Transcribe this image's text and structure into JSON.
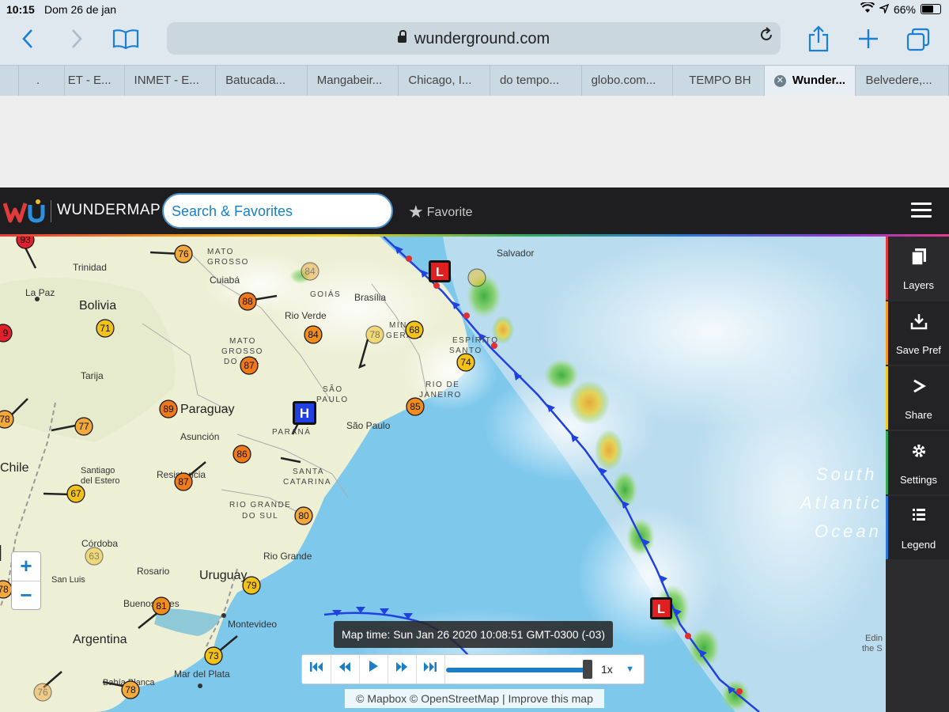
{
  "status_bar": {
    "time": "10:15",
    "date": "Dom 26 de jan",
    "battery": "66%"
  },
  "browser": {
    "url": "wunderground.com",
    "tabs": [
      {
        "label": "."
      },
      {
        "label": "ET - E..."
      },
      {
        "label": "INMET - E..."
      },
      {
        "label": "Batucada..."
      },
      {
        "label": "Mangabeir..."
      },
      {
        "label": "Chicago, I..."
      },
      {
        "label": "do tempo..."
      },
      {
        "label": "globo.com..."
      },
      {
        "label": "TEMPO BH"
      },
      {
        "label": "Wunder...",
        "active": true
      },
      {
        "label": "Belvedere,..."
      }
    ]
  },
  "wundermap": {
    "brand": "WUNDERMAP",
    "search_placeholder": "Search & Favorites",
    "favorite_label": "Favorite"
  },
  "side_panel": [
    {
      "label": "Layers",
      "icon": "layers-icon",
      "accent": "#e03a3a"
    },
    {
      "label": "Save Pref",
      "icon": "download-icon",
      "accent": "#f39a1b"
    },
    {
      "label": "Share",
      "icon": "share-icon",
      "accent": "#f2cc1b"
    },
    {
      "label": "Settings",
      "icon": "gear-icon",
      "accent": "#36a85a"
    },
    {
      "label": "Legend",
      "icon": "list-icon",
      "accent": "#2d77d4"
    }
  ],
  "map": {
    "zoom_in": "+",
    "zoom_out": "−",
    "map_time": "Map time: Sun Jan 26 2020 10:08:51 GMT-0300 (-03)",
    "speed": "1x",
    "attribution": "© Mapbox © OpenStreetMap | Improve this map",
    "labels": {
      "bolivia": "Bolivia",
      "paraguay": "Paraguay",
      "chile": "Chile",
      "argentina": "Argentina",
      "uruguay": "Uruguay",
      "mato_grosso": [
        "MATO",
        "GROSSO"
      ],
      "mato_grosso_do_sul": [
        "MATO",
        "GROSSO",
        "DO SUL"
      ],
      "goias": "GOIÁS",
      "minas_gerais": [
        "MINAS",
        "GERAIS"
      ],
      "espirito_santo": [
        "ESPÍRITO",
        "SANTO"
      ],
      "sao_paulo_state": [
        "SÃO",
        "PAULO"
      ],
      "rio_de_janeiro_state": [
        "RIO DE",
        "JANEIRO"
      ],
      "parana": "PARANÁ",
      "santa_catarina": [
        "SANTA",
        "CATARINA"
      ],
      "rio_grande_do_sul": [
        "RIO GRANDE",
        "DO SUL"
      ],
      "trinidad": "Trinidad",
      "la_paz": "La Paz",
      "cuiaba": "Cuiabá",
      "rio_verde": "Rio Verde",
      "brasilia": "Brasília",
      "salvador": "Salvador",
      "tarija": "Tarija",
      "asuncion": "Asunción",
      "santiago_del_estero": [
        "Santiago",
        "del Estero"
      ],
      "resistencia": "Resistencia",
      "sao_paulo": "São Paulo",
      "cordoba": "Córdoba",
      "rosario": "Rosario",
      "san_luis": "San Luis",
      "buenos_aires": "Buenos Aires",
      "montevideo": "Montevideo",
      "rio_grande": "Rio Grande",
      "mar_del_plata": "Mar del Plata",
      "bahia_blanca": "Bahía Blanca",
      "south_atlantic_ocean": [
        "South",
        "Atlantic",
        "Ocean"
      ],
      "edinburgh": [
        "Edin",
        "the S"
      ]
    },
    "station_temps": {
      "t93": "93",
      "t76a": "76",
      "t84a": "84",
      "t88": "88",
      "t71": "71",
      "t84b": "84",
      "t87a": "87",
      "t78a": "78",
      "t68": "68",
      "t74": "74",
      "t89": "89",
      "t77": "77",
      "t78b": "78",
      "t85": "85",
      "t86": "86",
      "t87b": "87",
      "t67": "67",
      "t80": "80",
      "t63": "63",
      "t79": "79",
      "t78c": "78",
      "t81": "81",
      "t73": "73",
      "t76b": "76",
      "t78d": "78",
      "t9x": "9"
    },
    "pressure_systems": {
      "high": "H",
      "low": "L"
    }
  }
}
